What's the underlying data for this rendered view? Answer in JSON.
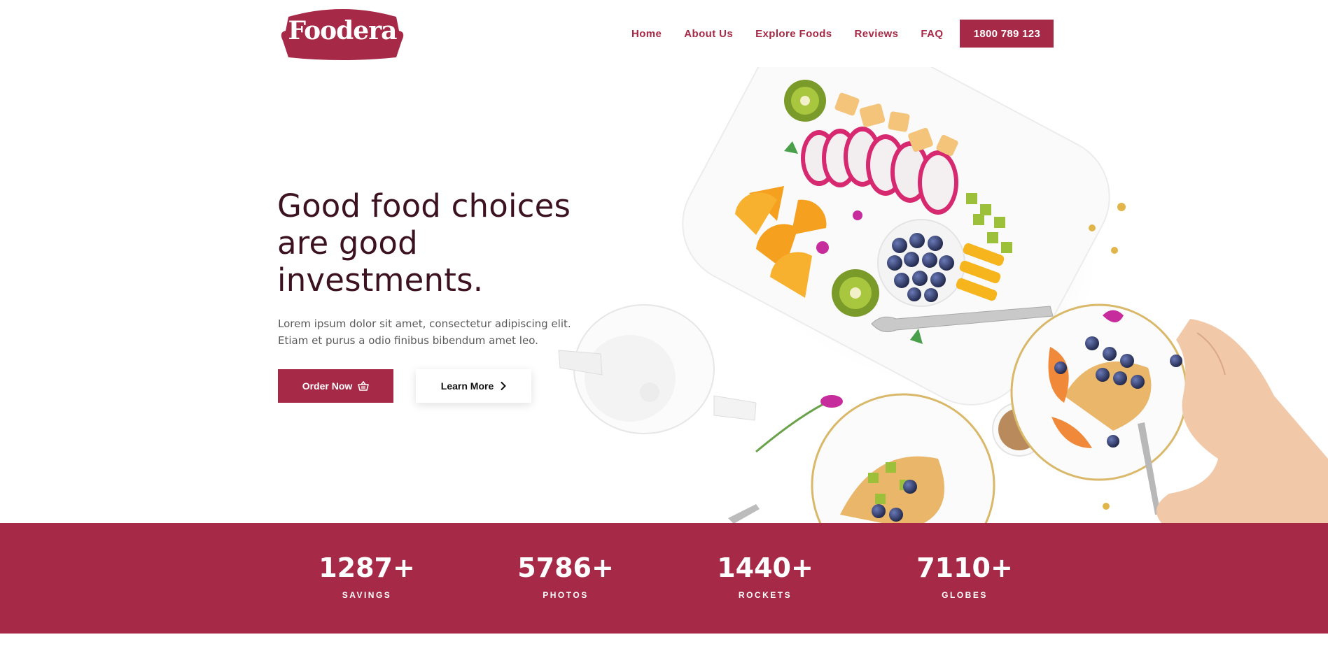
{
  "brand": {
    "name": "Foodera",
    "color": "#a62a47"
  },
  "nav": {
    "items": [
      "Home",
      "About Us",
      "Explore Foods",
      "Reviews",
      "FAQ"
    ],
    "phone": "1800 789 123"
  },
  "hero": {
    "title": "Good food choices are good investments.",
    "text": "Lorem ipsum dolor sit amet, consectetur adipiscing elit. Etiam et purus a odio finibus bibendum amet leo.",
    "order_label": "Order Now",
    "learn_label": "Learn More"
  },
  "icons": {
    "order": "basket-icon",
    "learn": "chevron-right-icon"
  },
  "stats": [
    {
      "value": "1287+",
      "label": "SAVINGS"
    },
    {
      "value": "5786+",
      "label": "PHOTOS"
    },
    {
      "value": "1440+",
      "label": "ROCKETS"
    },
    {
      "value": "7110+",
      "label": "GLOBES"
    }
  ]
}
